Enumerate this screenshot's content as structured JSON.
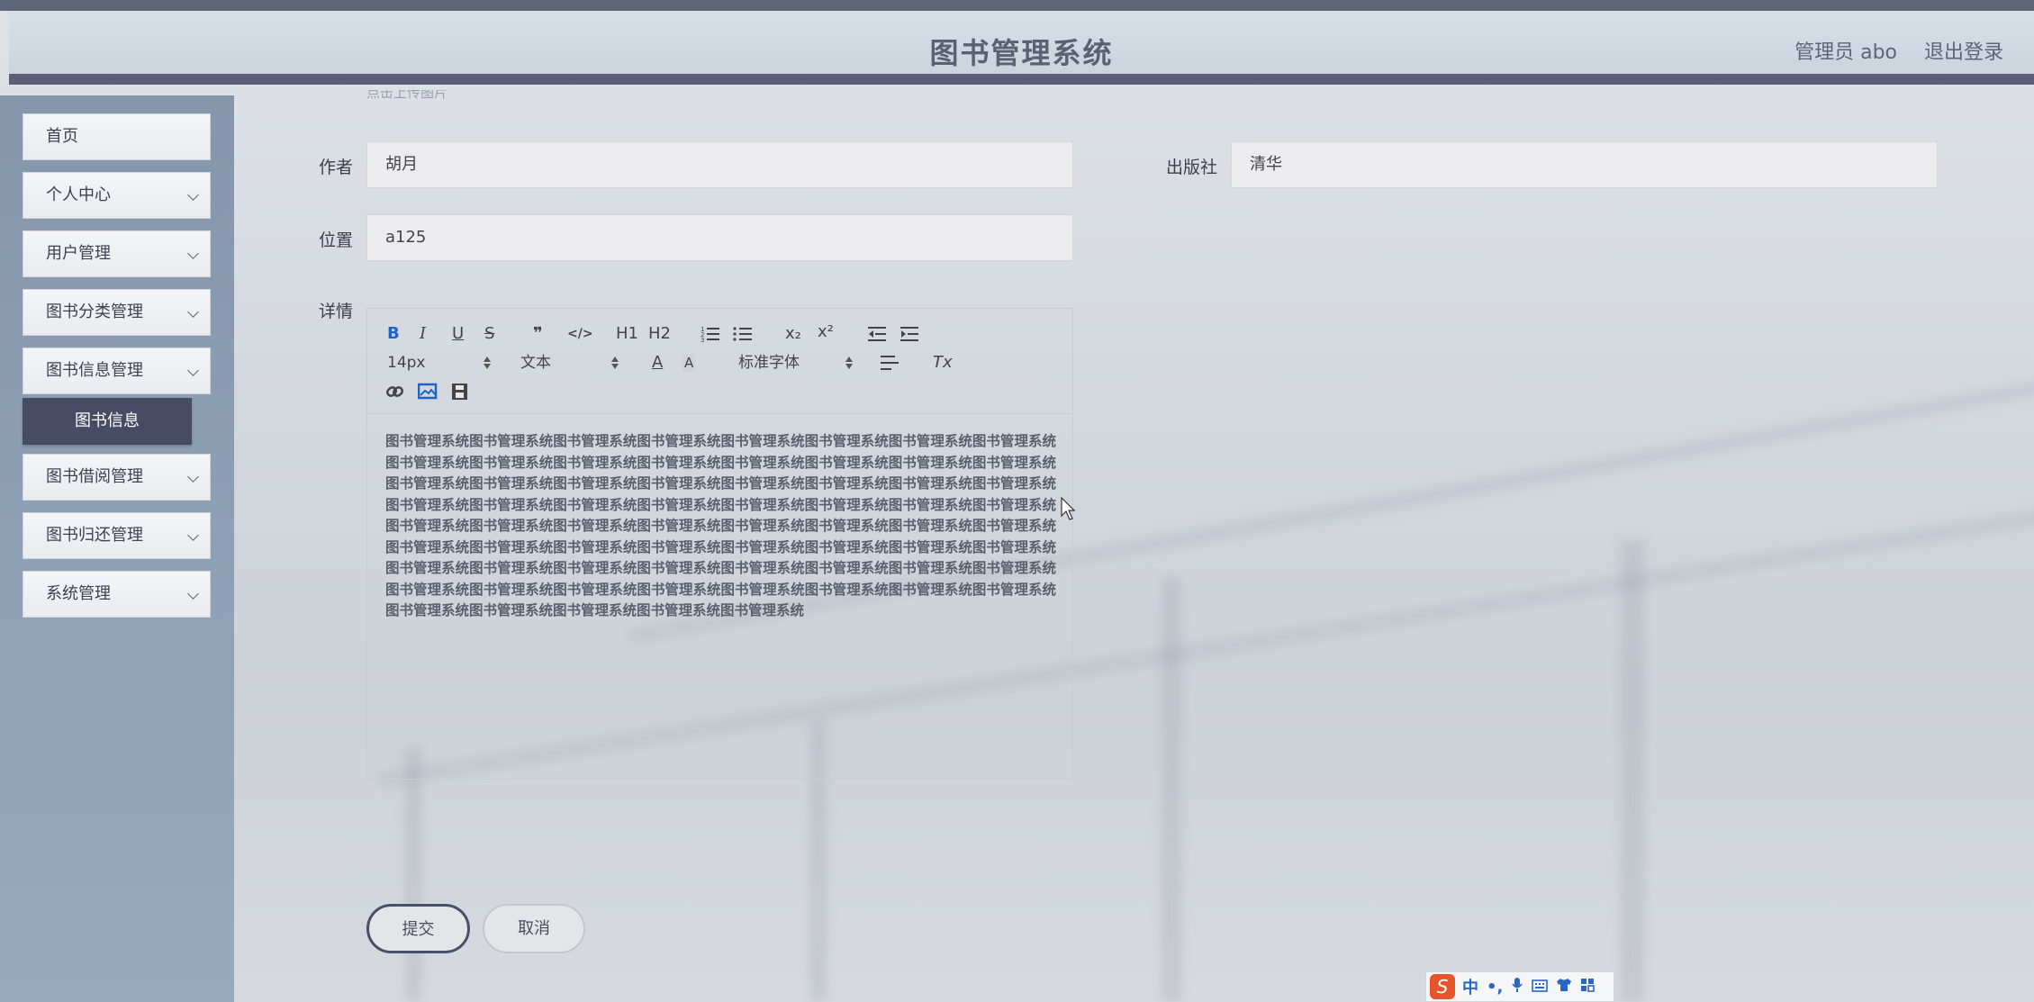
{
  "header": {
    "title": "图书管理系统",
    "user": "管理员 abo",
    "logout": "退出登录"
  },
  "sidebar": {
    "items": [
      {
        "label": "首页"
      },
      {
        "label": "个人中心"
      },
      {
        "label": "用户管理"
      },
      {
        "label": "图书分类管理"
      },
      {
        "label": "图书信息管理"
      },
      {
        "label": "图书借阅管理"
      },
      {
        "label": "图书归还管理"
      },
      {
        "label": "系统管理"
      }
    ],
    "active_sub": "图书信息"
  },
  "form": {
    "cut_label": "点击上传图片",
    "author_label": "作者",
    "author_value": "胡月",
    "publisher_label": "出版社",
    "publisher_value": "清华",
    "location_label": "位置",
    "location_value": "a125",
    "detail_label": "详情"
  },
  "editor": {
    "toolbar": {
      "bold": "B",
      "italic": "I",
      "underline": "U",
      "strike": "S",
      "quote": "❞",
      "code": "</>",
      "h1": "H1",
      "h2": "H2",
      "sub": "x₂",
      "sup": "x²",
      "size": "14px",
      "header_select": "文本",
      "font_select": "标准字体",
      "clean": "Tx"
    },
    "content": "图书管理系统图书管理系统图书管理系统图书管理系统图书管理系统图书管理系统图书管理系统图书管理系统图书管理系统图书管理系统图书管理系统图书管理系统图书管理系统图书管理系统图书管理系统图书管理系统图书管理系统图书管理系统图书管理系统图书管理系统图书管理系统图书管理系统图书管理系统图书管理系统图书管理系统图书管理系统图书管理系统图书管理系统图书管理系统图书管理系统图书管理系统图书管理系统图书管理系统图书管理系统图书管理系统图书管理系统图书管理系统图书管理系统图书管理系统图书管理系统图书管理系统图书管理系统图书管理系统图书管理系统图书管理系统图书管理系统图书管理系统图书管理系统图书管理系统图书管理系统图书管理系统图书管理系统图书管理系统图书管理系统图书管理系统图书管理系统图书管理系统图书管理系统图书管理系统图书管理系统图书管理系统图书管理系统图书管理系统图书管理系统图书管理系统图书管理系统图书管理系统图书管理系统图书管理系统"
  },
  "buttons": {
    "submit": "提交",
    "cancel": "取消"
  },
  "ime": {
    "logo": "S",
    "mode": "中",
    "punct": "•,"
  }
}
